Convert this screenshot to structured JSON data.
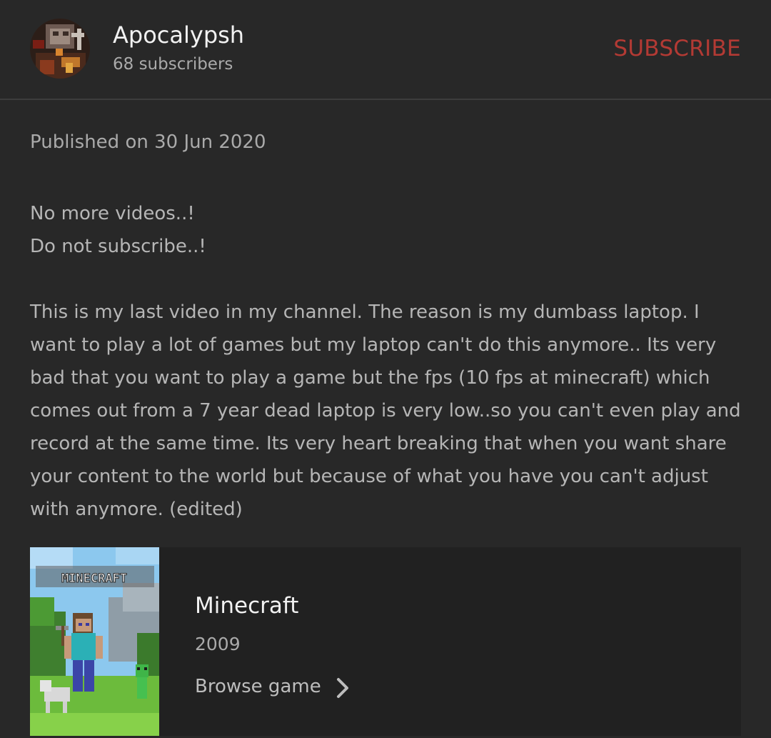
{
  "channel": {
    "name": "Apocalypsh",
    "subscribers": "68 subscribers",
    "subscribe_label": "SUBSCRIBE"
  },
  "video": {
    "published": "Published on 30 Jun 2020",
    "description_lines": [
      "No more videos..!",
      "Do not subscribe..!"
    ],
    "description_paragraph": "This is my last video in my channel. The reason is my dumbass laptop. I want to play a lot of games but my laptop can't do this anymore.. Its very bad that you want to play a game but the fps (10 fps at minecraft) which comes out from a 7 year dead laptop is very low..so you can't even play and record at the same time. Its very heart breaking that when you want share your content to the world but because of what you have you can't adjust with anymore. (edited)"
  },
  "game": {
    "logo_text": "MINECRAFT",
    "title": "Minecraft",
    "year": "2009",
    "browse_label": "Browse game",
    "browse_icon": "chevron-right-icon"
  },
  "colors": {
    "background": "#282828",
    "card_background": "#212121",
    "subscribe_accent": "#b33a34",
    "divider": "#3d3d3d"
  }
}
